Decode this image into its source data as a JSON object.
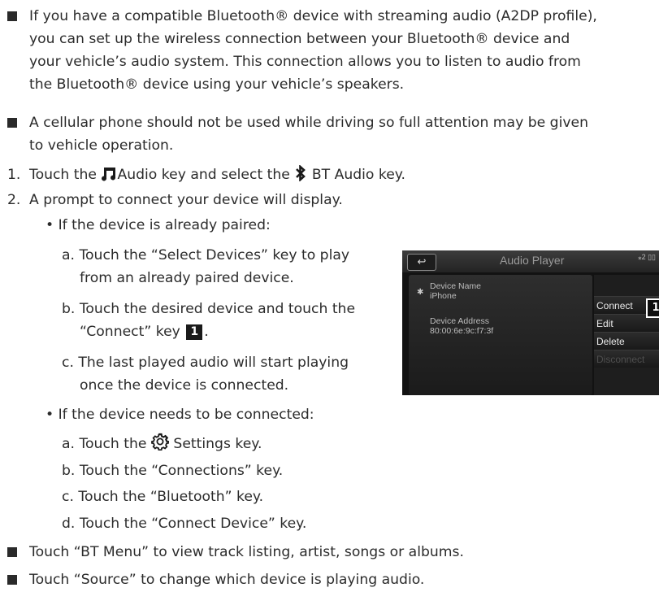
{
  "bullets": {
    "b1": [
      "If you have a compatible Bluetooth® device with streaming audio (A2DP profile),",
      "you can set up the wireless connection between your Bluetooth® device and",
      "your vehicle’s audio system. This connection allows you to listen to audio from",
      "the Bluetooth® device using your vehicle’s speakers."
    ],
    "b2": [
      "A cellular phone should not be used while driving so full attention may be given",
      "to vehicle operation."
    ],
    "b3": "Touch “BT Menu” to view track listing, artist, songs or albums.",
    "b4": "Touch “Source” to change which device is playing audio."
  },
  "steps": {
    "s1_num": "1.",
    "s1_a": "Touch the",
    "s1_b": "Audio key and select the",
    "s1_c": "BT Audio key.",
    "s2_num": "2.",
    "s2": "A prompt to connect your device will display."
  },
  "paired": {
    "heading": "• If the device is already paired:",
    "a": [
      "a. Touch the “Select Devices” key to play",
      "from an already paired device."
    ],
    "b1": "b. Touch the desired device and touch the",
    "b2_a": "“Connect” key",
    "b2_b": ".",
    "callout": "1",
    "c": [
      "c. The last played audio will start playing",
      "once the device is connected."
    ]
  },
  "connect": {
    "heading": "• If the device needs to be connected:",
    "a1": "a. Touch the",
    "a2": "Settings key.",
    "b": "b. Touch the “Connections” key.",
    "c": "c. Touch the “Bluetooth” key.",
    "d": "d. Touch the “Connect Device” key."
  },
  "screen": {
    "back": "↩",
    "title": "Audio Player",
    "status": "⁎2 ▯▯",
    "bt_glyph": "✱",
    "device_name_label": "Device Name",
    "device_name": "iPhone",
    "device_address_label": "Device Address",
    "device_address": "80:00:6e:9c:f7:3f",
    "menu": [
      "Connect",
      "Edit",
      "Delete",
      "Disconnect"
    ],
    "callout": "1"
  }
}
